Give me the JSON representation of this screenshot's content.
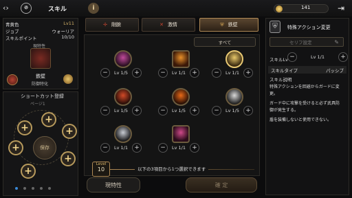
{
  "header": {
    "title": "スキル",
    "gold": "141",
    "info_icon": "info-icon"
  },
  "profile": {
    "rows": [
      [
        "青黄色",
        "Lv11"
      ],
      [
        "ジョブ",
        "ウォーリア"
      ],
      [
        "スキルポイント",
        "10/10"
      ]
    ],
    "current_label": "現特性",
    "trait_name": "鉄壁",
    "trait_desc": "防御特化"
  },
  "shortcut": {
    "title": "ショートカット登録",
    "subtitle": "ページ1",
    "save_label": "保存"
  },
  "tabs": [
    {
      "label": "剛腕"
    },
    {
      "label": "激情"
    },
    {
      "label": "鉄壁"
    }
  ],
  "filter": {
    "label": "すべて"
  },
  "skills": [
    {
      "level": "Lv 1/5",
      "color": "#a02d7a"
    },
    {
      "level": "Lv 1/1",
      "color": "#c06a1a"
    },
    {
      "level": "Lv 1/1",
      "color": "#c8a040"
    },
    {
      "level": "Lv 1/5",
      "color": "#b23a1e"
    },
    {
      "level": "Lv 1/5",
      "color": "#c05a10"
    },
    {
      "level": "Lv 1/5",
      "color": "#b8b8b8"
    },
    {
      "level": "Lv 1/1",
      "color": "#9aa0a8"
    },
    {
      "level": "Lv 1/1",
      "color": "#b0306a"
    }
  ],
  "footer": {
    "level_tag": "Level",
    "level_num": "10",
    "hint": "以下の3項目から1つ選択できます",
    "trait_btn": "現特性",
    "confirm_btn": "確 定"
  },
  "detail": {
    "title": "特殊アクション変更",
    "set_label": "セリフ設定",
    "skill_lv_label": "スキルLv",
    "skill_lv_value": "Lv 1/1",
    "type_label": "スキルタイプ",
    "type_value": "パッシブ",
    "desc_label": "スキル説明",
    "desc_lines": [
      "特殊アクションを回避からガードに変",
      "更。",
      "ガード中に攻撃を受けると必ず武具防",
      "御が発生する。",
      "盾を装備しないと使用できない。"
    ]
  }
}
